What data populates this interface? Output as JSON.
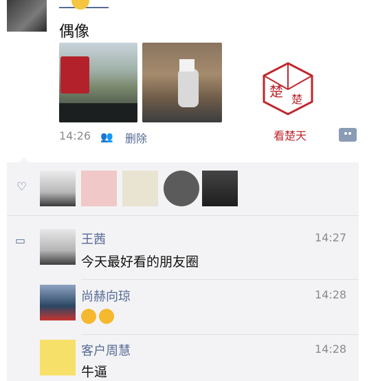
{
  "post": {
    "text": "偶像",
    "time": "14:26",
    "delete_label": "删除",
    "watermark_caption": "看楚天"
  },
  "likes": {
    "count_shown": 5
  },
  "comments": [
    {
      "name": "王茜",
      "time": "14:27",
      "text": "今天最好看的朋友圈"
    },
    {
      "name": "尚赫向琼",
      "time": "14:28",
      "text": ""
    },
    {
      "name": "客户周慧",
      "time": "14:28",
      "text": "牛逼"
    }
  ],
  "colors": {
    "link": "#576b95",
    "watermark": "#c0262d",
    "comment_bg": "#f3f3f5"
  },
  "icons": [
    "heart-icon",
    "comment-icon",
    "people-icon",
    "more-actions-icon"
  ]
}
